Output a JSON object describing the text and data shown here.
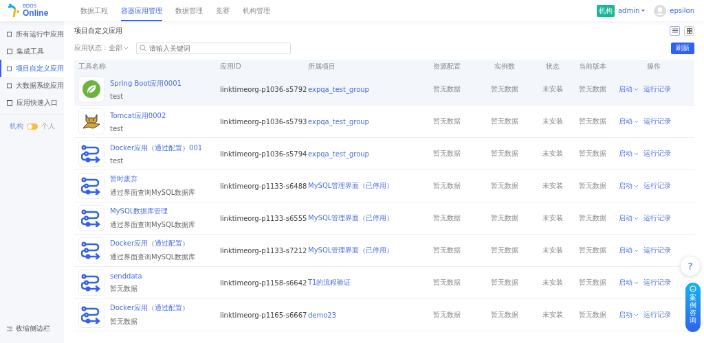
{
  "logo": {
    "small": "BDOS",
    "name": "Online"
  },
  "nav_tabs": [
    {
      "label": "数据工程",
      "selected": false
    },
    {
      "label": "容器应用管理",
      "selected": true
    },
    {
      "label": "数据管理",
      "selected": false
    },
    {
      "label": "竞赛",
      "selected": false
    },
    {
      "label": "机构管理",
      "selected": false
    }
  ],
  "user": {
    "org_badge": "机构",
    "account": "admin",
    "name": "epsilon"
  },
  "sidebar": {
    "items": [
      {
        "label": "所有运行中应用",
        "selected": false
      },
      {
        "label": "集成工具",
        "selected": false
      },
      {
        "label": "项目自定义应用",
        "selected": true
      },
      {
        "label": "大数据系统应用",
        "selected": false
      },
      {
        "label": "应用快速入口",
        "selected": false
      }
    ],
    "switch": {
      "left_label": "机构",
      "right_label": "个人",
      "on": false
    },
    "collapse": "收缩侧边栏"
  },
  "page_title": "项目自定义应用",
  "filter": {
    "label": "应用状态：全部",
    "placeholder": "请输入关键词"
  },
  "refresh_button": "刷新",
  "table": {
    "columns": [
      "工具名称",
      "应用ID",
      "所属项目",
      "资源配置",
      "实例数",
      "状态",
      "当前版本",
      "操作"
    ],
    "rows": [
      {
        "kind": "spring",
        "name": "Spring Boot应用0001",
        "desc": "test",
        "id": "linktimeorg-p1036-s5792",
        "project": "expqa_test_group",
        "resource": "暂无数据",
        "instances": "暂无数据",
        "status": "未安装",
        "version": "暂无数据",
        "start": "启动",
        "log": "运行记录",
        "selected": true
      },
      {
        "kind": "tomcat",
        "name": "Tomcat应用0002",
        "desc": "test",
        "id": "linktimeorg-p1036-s5793",
        "project": "expqa_test_group",
        "resource": "暂无数据",
        "instances": "暂无数据",
        "status": "未安装",
        "version": "暂无数据",
        "start": "启动",
        "log": "运行记录",
        "selected": false
      },
      {
        "kind": "flow",
        "name": "Docker应用（通过配置）001",
        "desc": "test",
        "id": "linktimeorg-p1036-s5794",
        "project": "expqa_test_group",
        "resource": "暂无数据",
        "instances": "暂无数据",
        "status": "未安装",
        "version": "暂无数据",
        "start": "启动",
        "log": "运行记录",
        "selected": false
      },
      {
        "kind": "flow",
        "name": "暂时废弃",
        "desc": "通过界面查询MySQL数据库",
        "id": "linktimeorg-p1133-s6488",
        "project": "MySQL管理界面（已停用）",
        "resource": "暂无数据",
        "instances": "暂无数据",
        "status": "未安装",
        "version": "暂无数据",
        "start": "启动",
        "log": "运行记录",
        "selected": false
      },
      {
        "kind": "flow",
        "name": "MySQL数据库管理",
        "desc": "通过界面查询MySQL数据库",
        "id": "linktimeorg-p1133-s6555",
        "project": "MySQL管理界面（已停用）",
        "resource": "暂无数据",
        "instances": "暂无数据",
        "status": "未安装",
        "version": "暂无数据",
        "start": "启动",
        "log": "运行记录",
        "selected": false
      },
      {
        "kind": "flow",
        "name": "Docker应用（通过配置）",
        "desc": "通过界面查询MySQL数据库",
        "id": "linktimeorg-p1133-s7212",
        "project": "MySQL管理界面（已停用）",
        "resource": "暂无数据",
        "instances": "暂无数据",
        "status": "未安装",
        "version": "暂无数据",
        "start": "启动",
        "log": "运行记录",
        "selected": false
      },
      {
        "kind": "flow",
        "name": "senddata",
        "desc": "暂无数据",
        "id": "linktimeorg-p1158-s6642",
        "project": "T1的流程验证",
        "resource": "暂无数据",
        "instances": "暂无数据",
        "status": "未安装",
        "version": "暂无数据",
        "start": "启动",
        "log": "运行记录",
        "selected": false
      },
      {
        "kind": "flow",
        "name": "Docker应用（通过配置）",
        "desc": "暂无数据",
        "id": "linktimeorg-p1165-s6667",
        "project": "demo23",
        "resource": "暂无数据",
        "instances": "暂无数据",
        "status": "未安装",
        "version": "暂无数据",
        "start": "启动",
        "log": "运行记录",
        "selected": false
      }
    ]
  },
  "help_button": "?",
  "consult_button": "案例咨询"
}
